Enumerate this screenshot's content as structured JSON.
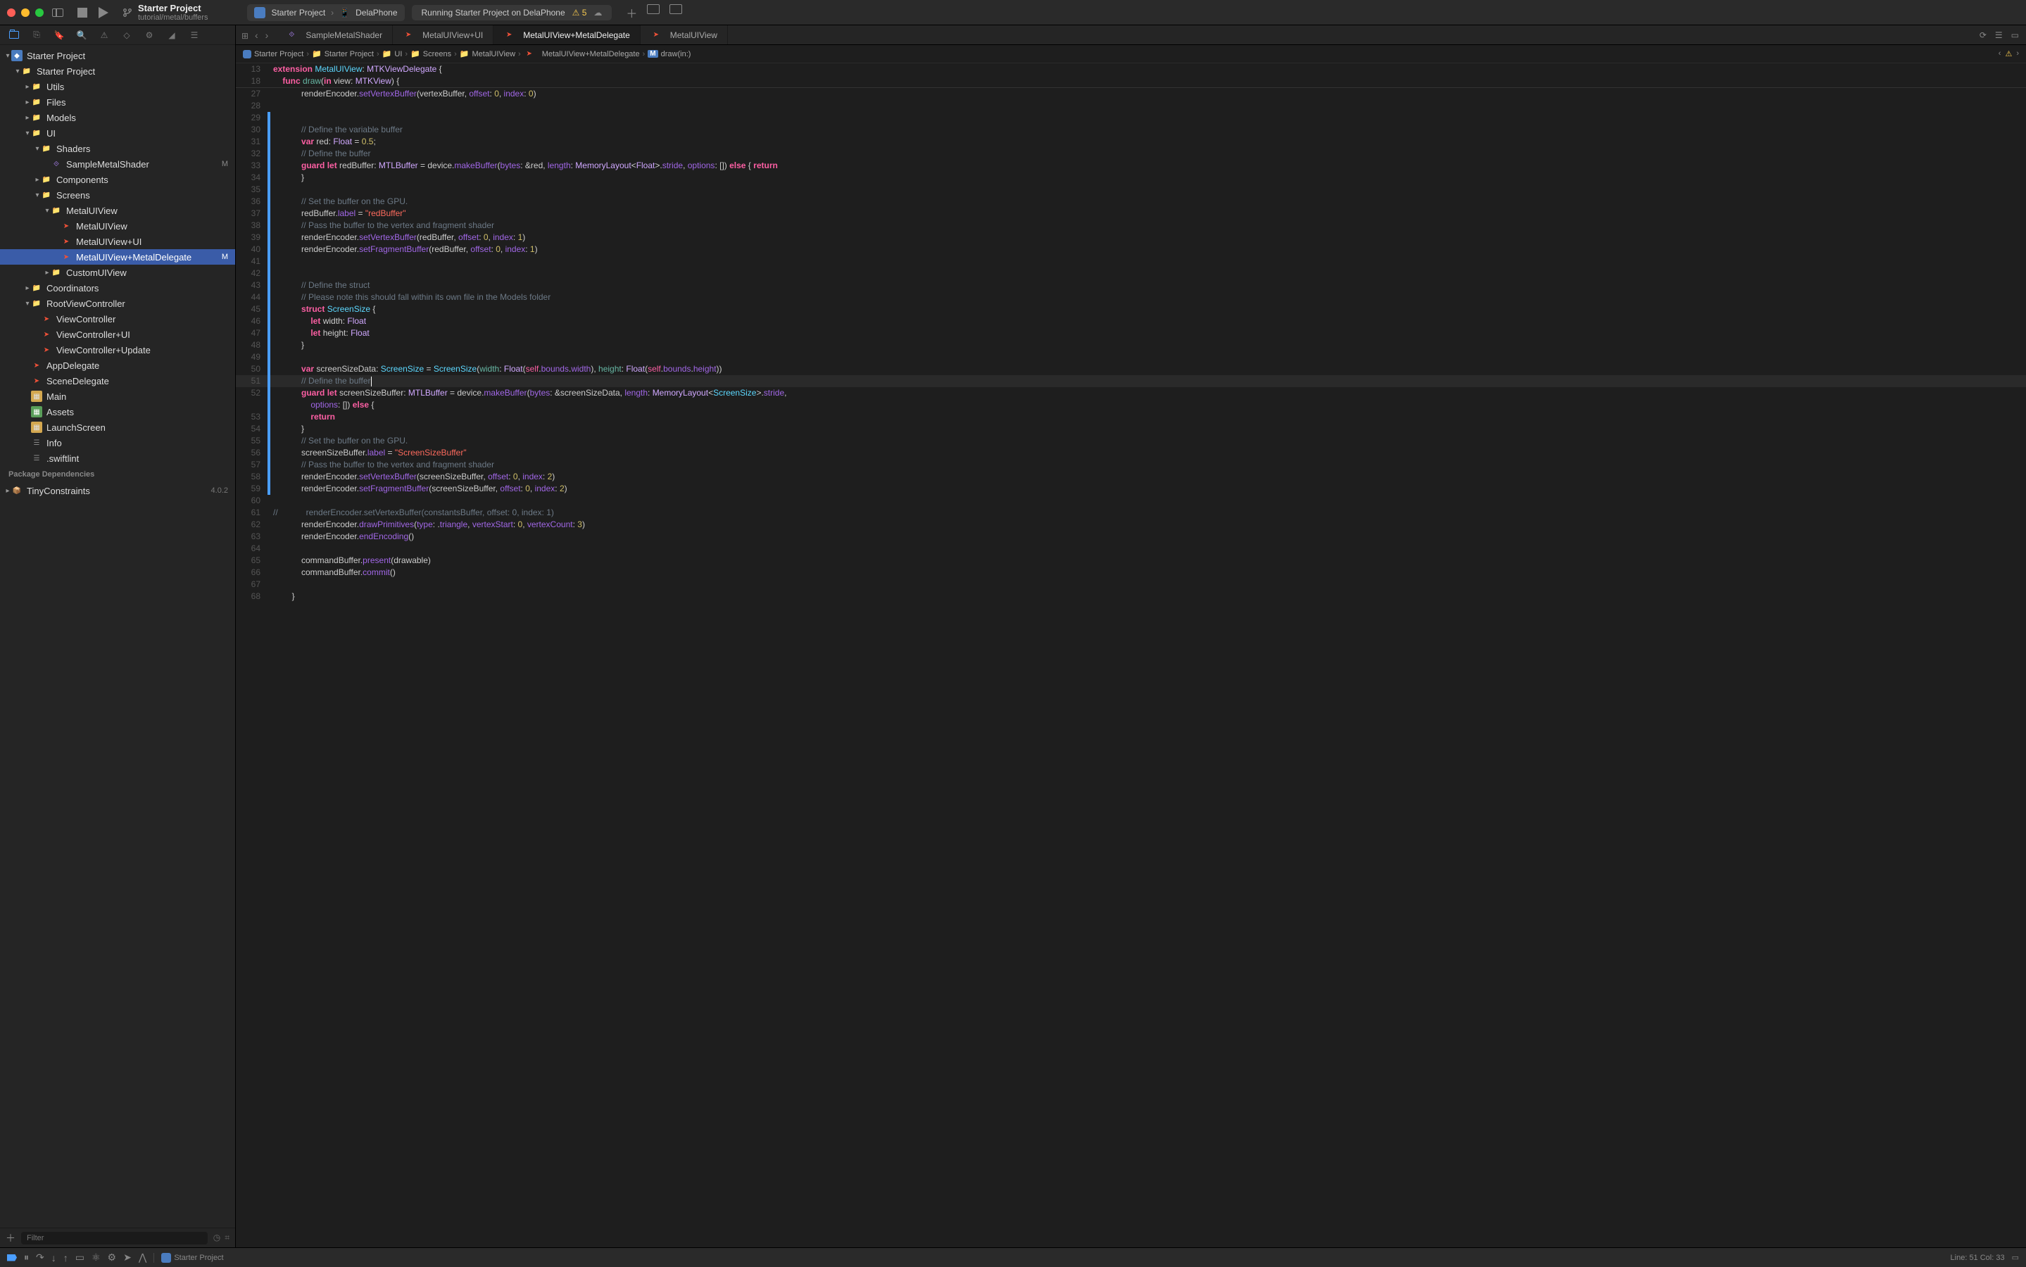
{
  "titlebar": {
    "project_name": "Starter Project",
    "project_path": "tutorial/metal/buffers",
    "scheme": "Starter Project",
    "destination": "DelaPhone",
    "status": "Running Starter Project on DelaPhone",
    "warning_count": "5"
  },
  "tabs": [
    {
      "icon": "metal",
      "label": "SampleMetalShader"
    },
    {
      "icon": "swift",
      "label": "MetalUIView+UI"
    },
    {
      "icon": "swift",
      "label": "MetalUIView+MetalDelegate",
      "active": true
    },
    {
      "icon": "swift",
      "label": "MetalUIView"
    }
  ],
  "jump_bar": [
    "Starter Project",
    "Starter Project",
    "UI",
    "Screens",
    "MetalUIView",
    "MetalUIView+MetalDelegate",
    "draw(in:)"
  ],
  "tree": {
    "project": "Starter Project",
    "group": "Starter Project",
    "utils": "Utils",
    "files": "Files",
    "models": "Models",
    "ui": "UI",
    "shaders": "Shaders",
    "sample_shader": "SampleMetalShader",
    "components": "Components",
    "screens": "Screens",
    "metaluiview_folder": "MetalUIView",
    "metaluiview": "MetalUIView",
    "metaluiview_ui": "MetalUIView+UI",
    "metaluiview_delegate": "MetalUIView+MetalDelegate",
    "customuiview": "CustomUIView",
    "coordinators": "Coordinators",
    "rootvc": "RootViewController",
    "viewcontroller": "ViewController",
    "viewcontroller_ui": "ViewController+UI",
    "viewcontroller_update": "ViewController+Update",
    "appdelegate": "AppDelegate",
    "scenedelegate": "SceneDelegate",
    "main": "Main",
    "assets": "Assets",
    "launchscreen": "LaunchScreen",
    "info": "Info",
    "swiftlint": ".swiftlint",
    "deps_header": "Package Dependencies",
    "tinyconstraints": "TinyConstraints",
    "tinyconstraints_ver": "4.0.2",
    "modified_badge": "M"
  },
  "filter": {
    "placeholder": "Filter"
  },
  "code": {
    "l13": "extension MetalUIView: MTKViewDelegate {",
    "l18": "    func draw(in view: MTKView) {",
    "l27": "            renderEncoder.setVertexBuffer(vertexBuffer, offset: 0, index: 0)",
    "l28": "",
    "l29": "",
    "l30": "            // Define the variable buffer",
    "l31": "            var red: Float = 0.5;",
    "l32": "            // Define the buffer",
    "l33": "            guard let redBuffer: MTLBuffer = device.makeBuffer(bytes: &red, length: MemoryLayout<Float>.stride, options: []) else { return",
    "l34": "            }",
    "l35": "",
    "l36": "            // Set the buffer on the GPU.",
    "l37": "            redBuffer.label = \"redBuffer\"",
    "l38": "            // Pass the buffer to the vertex and fragment shader",
    "l39": "            renderEncoder.setVertexBuffer(redBuffer, offset: 0, index: 1)",
    "l40": "            renderEncoder.setFragmentBuffer(redBuffer, offset: 0, index: 1)",
    "l41": "",
    "l42": "",
    "l43": "            // Define the struct",
    "l44": "            // Please note this should fall within its own file in the Models folder",
    "l45": "            struct ScreenSize {",
    "l46": "                let width: Float",
    "l47": "                let height: Float",
    "l48": "            }",
    "l49": "",
    "l50": "            var screenSizeData: ScreenSize = ScreenSize(width: Float(self.bounds.width), height: Float(self.bounds.height))",
    "l51": "            // Define the buffer",
    "l52": "            guard let screenSizeBuffer: MTLBuffer = device.makeBuffer(bytes: &screenSizeData, length: MemoryLayout<ScreenSize>.stride,",
    "l52b": "                options: []) else {",
    "l53": "                return",
    "l54": "            }",
    "l55": "            // Set the buffer on the GPU.",
    "l56": "            screenSizeBuffer.label = \"ScreenSizeBuffer\"",
    "l57": "            // Pass the buffer to the vertex and fragment shader",
    "l58": "            renderEncoder.setVertexBuffer(screenSizeBuffer, offset: 0, index: 2)",
    "l59": "            renderEncoder.setFragmentBuffer(screenSizeBuffer, offset: 0, index: 2)",
    "l60": "",
    "l61": "//            renderEncoder.setVertexBuffer(constantsBuffer, offset: 0, index: 1)",
    "l62": "            renderEncoder.drawPrimitives(type: .triangle, vertexStart: 0, vertexCount: 3)",
    "l63": "            renderEncoder.endEncoding()",
    "l64": "",
    "l65": "            commandBuffer.present(drawable)",
    "l66": "            commandBuffer.commit()",
    "l67": "",
    "l68": "        }"
  },
  "debug": {
    "target": "Starter Project",
    "cursor": "Line: 51  Col: 33"
  }
}
